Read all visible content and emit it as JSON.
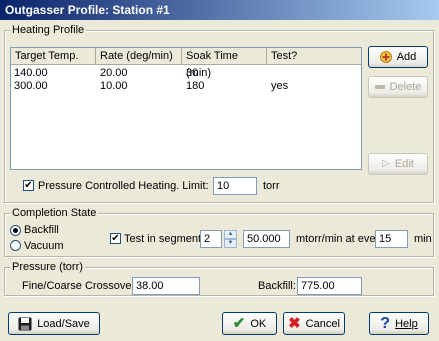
{
  "window": {
    "title": "Outgasser Profile: Station #1"
  },
  "heating_profile": {
    "legend": "Heating Profile",
    "columns": [
      "Target Temp.",
      "Rate (deg/min)",
      "Soak Time (min)",
      "Test?"
    ],
    "rows": [
      [
        "140.00",
        "20.00",
        "30",
        ""
      ],
      [
        "300.00",
        "10.00",
        "180",
        "yes"
      ]
    ],
    "add_label": "Add",
    "delete_label": "Delete",
    "edit_label": "Edit",
    "pressure_controlled_label": "Pressure Controlled Heating. Limit:",
    "pressure_controlled_checked": "✔",
    "limit_value": "10",
    "limit_unit": "torr"
  },
  "completion_state": {
    "legend": "Completion State",
    "backfill_label": "Backfill",
    "vacuum_label": "Vacuum",
    "test_label": "Test in segment",
    "test_checked": "✔",
    "segment_value": "2",
    "rate_value": "50.000",
    "rate_unit": "mtorr/min at every:",
    "interval_value": "15",
    "interval_unit": "min"
  },
  "pressure": {
    "legend": "Pressure (torr)",
    "crossover_label": "Fine/Coarse Crossover:",
    "crossover_value": "38.00",
    "backfill_label": "Backfill:",
    "backfill_value": "775.00"
  },
  "footer": {
    "load_save_label": "Load/Save",
    "ok_label": "OK",
    "cancel_label": "Cancel",
    "help_label": "Help"
  },
  "colors": {
    "title_start": "#0a246a",
    "title_end": "#a6caf0",
    "ok_check": "#2e8b2e",
    "cancel_x": "#d42020",
    "help_q": "#1a3fa8"
  }
}
